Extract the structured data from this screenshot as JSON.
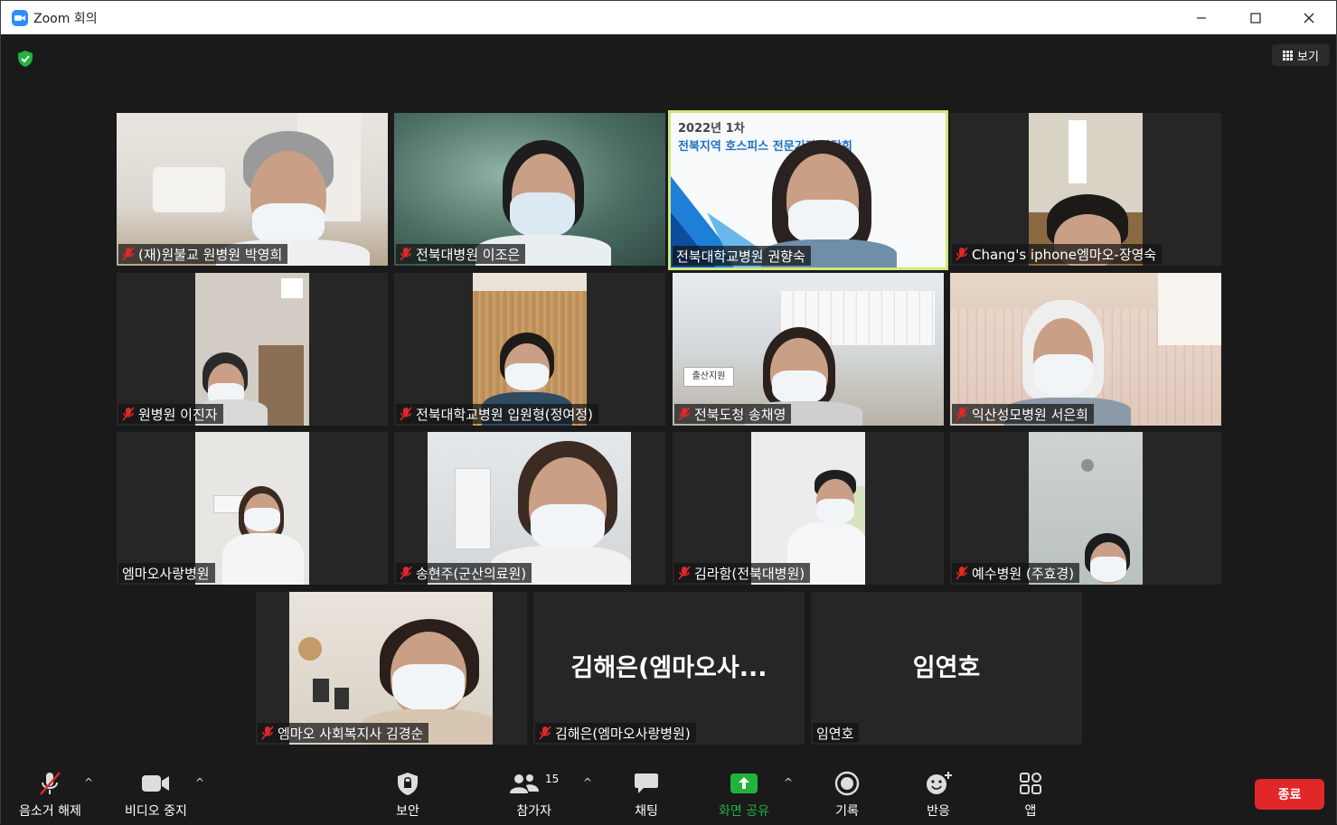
{
  "window": {
    "title": "Zoom 회의"
  },
  "header": {
    "view_label": "보기"
  },
  "participants": [
    {
      "name": "(재)원불교 원병원 박영희",
      "muted": true
    },
    {
      "name": "전북대병원 이조은",
      "muted": true
    },
    {
      "name": "전북대학교병원 권향숙",
      "muted": false,
      "active_speaker": true,
      "slide_line1": "2022년 1차",
      "slide_line2": "전북지역 호스피스 전문기관 간담회"
    },
    {
      "name": "Chang's iphone엠마오-장영숙",
      "muted": true
    },
    {
      "name": "원병원 이진자",
      "muted": true
    },
    {
      "name": "전북대학교병원 입원형(정여정)",
      "muted": true
    },
    {
      "name": "전북도청 송채영",
      "muted": true,
      "sign_text": "출산지원"
    },
    {
      "name": "익산성모병원 서은희",
      "muted": true
    },
    {
      "name": "엠마오사랑병원",
      "muted": false
    },
    {
      "name": "송현주(군산의료원)",
      "muted": true
    },
    {
      "name": "김라함(전북대병원)",
      "muted": true
    },
    {
      "name": "예수병원 (주효경)",
      "muted": true
    },
    {
      "name": "엠마오 사회복지사 김경순",
      "muted": true
    },
    {
      "name": "김해은(엠마오사랑병원)",
      "muted": true,
      "display_name": "김해은(엠마오사..."
    },
    {
      "name": "임연호",
      "muted": false,
      "display_name": "임연호"
    }
  ],
  "toolbar": {
    "unmute_label": "음소거 해제",
    "video_label": "비디오 중지",
    "security_label": "보안",
    "participants_label": "참가자",
    "participants_count": "15",
    "chat_label": "채팅",
    "share_label": "화면 공유",
    "record_label": "기록",
    "reactions_label": "반응",
    "apps_label": "앱",
    "end_label": "종료"
  },
  "colors": {
    "accent_green": "#22b33c",
    "active_border": "#cfe87a",
    "end_red": "#e02828",
    "brand_blue": "#2d8cff"
  },
  "icons": [
    "zoom-logo-icon",
    "minimize-icon",
    "maximize-icon",
    "close-icon",
    "encryption-shield-icon",
    "grid-view-icon",
    "mic-muted-icon",
    "video-camera-icon",
    "security-shield-icon",
    "participants-icon",
    "chat-icon",
    "share-screen-icon",
    "record-icon",
    "reactions-icon",
    "apps-icon"
  ]
}
